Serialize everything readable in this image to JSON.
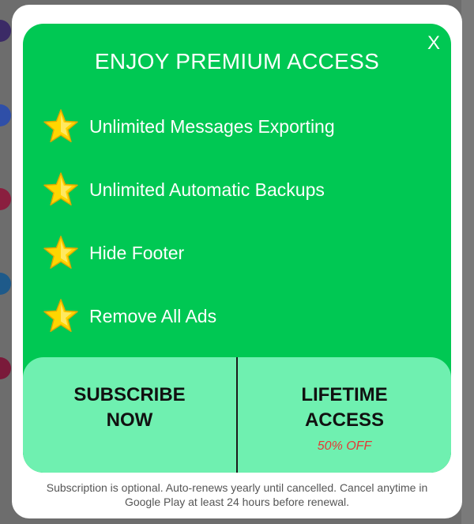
{
  "dialog": {
    "close_label": "X",
    "title": "ENJOY PREMIUM ACCESS",
    "features": [
      {
        "icon": "star-icon",
        "label": "Unlimited Messages Exporting"
      },
      {
        "icon": "star-icon",
        "label": "Unlimited Automatic Backups"
      },
      {
        "icon": "star-icon",
        "label": "Hide Footer"
      },
      {
        "icon": "star-icon",
        "label": "Remove All Ads"
      }
    ],
    "subscribe_button": {
      "label": "SUBSCRIBE\nNOW"
    },
    "lifetime_button": {
      "label": "LIFETIME\nACCESS",
      "discount": "50% OFF"
    },
    "disclaimer": "Subscription is optional. Auto-renews yearly until cancelled. Cancel anytime in Google Play at least 24 hours before renewal."
  },
  "colors": {
    "panel_green": "#00c853",
    "button_mint": "#6ff0b0",
    "discount_red": "#e53935",
    "star_yellow": "#ffd600"
  }
}
